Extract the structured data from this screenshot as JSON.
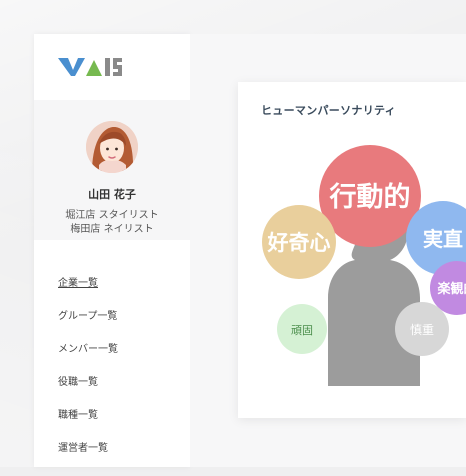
{
  "brand": {
    "logo_text": "VAIS",
    "colors": {
      "blue": "#4a8fcf",
      "green": "#76b94f",
      "gray": "#8a8a8a"
    }
  },
  "user": {
    "name": "山田 花子",
    "roles": [
      "堀江店 スタイリスト",
      "梅田店 ネイリスト"
    ]
  },
  "nav": {
    "items": [
      {
        "label": "企業一覧",
        "active": true
      },
      {
        "label": "グループ一覧",
        "active": false
      },
      {
        "label": "メンバー一覧",
        "active": false
      },
      {
        "label": "役職一覧",
        "active": false
      },
      {
        "label": "職種一覧",
        "active": false
      },
      {
        "label": "運営者一覧",
        "active": false
      }
    ]
  },
  "card": {
    "title": "ヒューマンパーソナリティ"
  },
  "chart_data": {
    "type": "bubble",
    "title": "ヒューマンパーソナリティ",
    "bubbles": [
      {
        "label": "行動的",
        "color": "#e87a7d"
      },
      {
        "label": "好奇心",
        "color": "#e9cf9c"
      },
      {
        "label": "実直",
        "color": "#8fb8ef"
      },
      {
        "label": "楽観的",
        "color": "#c18ae1"
      },
      {
        "label": "慎重",
        "color": "#d7d7d7"
      },
      {
        "label": "頑固",
        "color": "#d5f1d4"
      }
    ]
  }
}
